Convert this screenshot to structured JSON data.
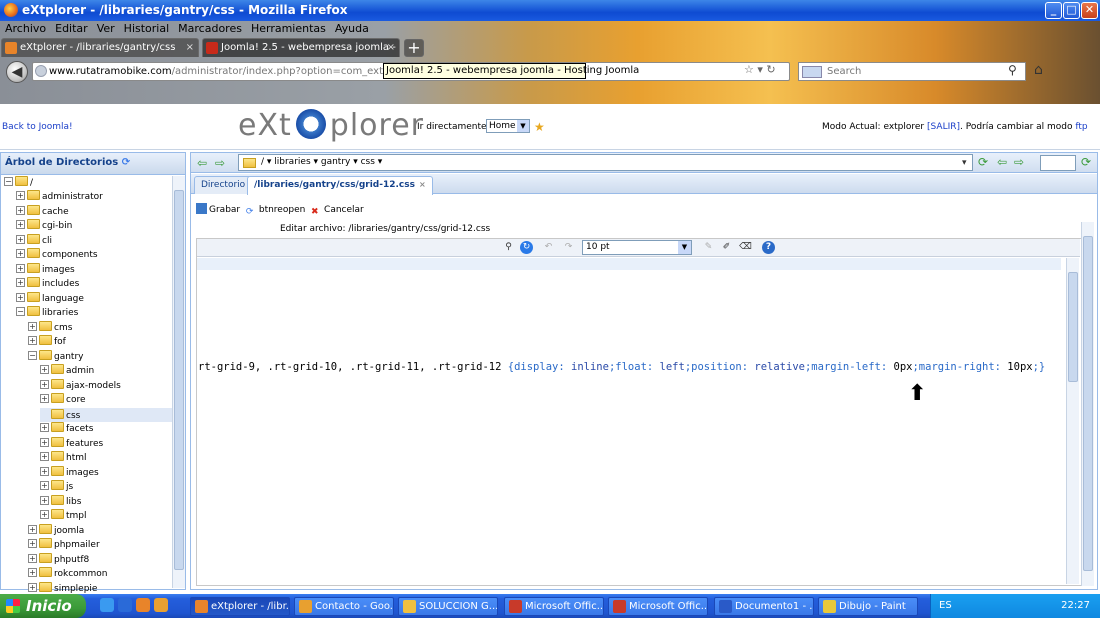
{
  "window": {
    "title": "eXtplorer - /libraries/gantry/css - Mozilla Firefox",
    "min": "_",
    "max": "□",
    "close": "✕"
  },
  "menubar": [
    "Archivo",
    "Editar",
    "Ver",
    "Historial",
    "Marcadores",
    "Herramientas",
    "Ayuda"
  ],
  "tabs": [
    {
      "label": "eXtplorer - /libraries/gantry/css",
      "close": "×"
    },
    {
      "label": "Joomla! 2.5 - webempresa joomla - Hosti...",
      "close": "×"
    }
  ],
  "newtab": "+",
  "nav": {
    "url_domain": "www.rutatramobike.com",
    "url_path": "/administrator/index.php?option=com_extplorer&tmpl=compo",
    "tooltip": "Joomla! 2.5 - webempresa joomla - Hosting Joomla",
    "search_placeholder": "Search"
  },
  "header": {
    "back_link": "Back to Joomla!",
    "logo_left": "eXt",
    "logo_right": "plorer",
    "goto_label": "Ir directamente a:",
    "goto_value": "Home",
    "mode_text": "Modo Actual: extplorer",
    "salir": "[SALIR]",
    "mode_suffix": ". Podría cambiar al modo",
    "ftp": "ftp"
  },
  "tree": {
    "title": "Árbol de Directorios",
    "root": "/",
    "items": [
      {
        "label": "administrator",
        "level": 1,
        "exp": "+"
      },
      {
        "label": "cache",
        "level": 1,
        "exp": "+"
      },
      {
        "label": "cgi-bin",
        "level": 1,
        "exp": "+"
      },
      {
        "label": "cli",
        "level": 1,
        "exp": "+"
      },
      {
        "label": "components",
        "level": 1,
        "exp": "+"
      },
      {
        "label": "images",
        "level": 1,
        "exp": "+"
      },
      {
        "label": "includes",
        "level": 1,
        "exp": "+"
      },
      {
        "label": "language",
        "level": 1,
        "exp": "+"
      },
      {
        "label": "libraries",
        "level": 1,
        "exp": "−"
      },
      {
        "label": "cms",
        "level": 2,
        "exp": "+"
      },
      {
        "label": "fof",
        "level": 2,
        "exp": "+"
      },
      {
        "label": "gantry",
        "level": 2,
        "exp": "−"
      },
      {
        "label": "admin",
        "level": 3,
        "exp": "+"
      },
      {
        "label": "ajax-models",
        "level": 3,
        "exp": "+"
      },
      {
        "label": "core",
        "level": 3,
        "exp": "+"
      },
      {
        "label": "css",
        "level": 3,
        "exp": "",
        "selected": true
      },
      {
        "label": "facets",
        "level": 3,
        "exp": "+"
      },
      {
        "label": "features",
        "level": 3,
        "exp": "+"
      },
      {
        "label": "html",
        "level": 3,
        "exp": "+"
      },
      {
        "label": "images",
        "level": 3,
        "exp": "+"
      },
      {
        "label": "js",
        "level": 3,
        "exp": "+"
      },
      {
        "label": "libs",
        "level": 3,
        "exp": "+"
      },
      {
        "label": "tmpl",
        "level": 3,
        "exp": "+"
      },
      {
        "label": "joomla",
        "level": 2,
        "exp": "+"
      },
      {
        "label": "phpmailer",
        "level": 2,
        "exp": "+"
      },
      {
        "label": "phputf8",
        "level": 2,
        "exp": "+"
      },
      {
        "label": "rokcommon",
        "level": 2,
        "exp": "+"
      },
      {
        "label": "simplepie",
        "level": 2,
        "exp": "+"
      }
    ]
  },
  "path": {
    "crumbs": "/ ▾  libraries ▾  gantry ▾  css ▾"
  },
  "editor_tabs": [
    {
      "label": "Directorio"
    },
    {
      "label": "/libraries/gantry/css/grid-12.css",
      "close": "×"
    }
  ],
  "edit_toolbar": {
    "save": "Grabar",
    "reopen": "btnreopen",
    "cancel": "Cancelar"
  },
  "edit_file_label": "Editar archivo: /libraries/gantry/css/grid-12.css",
  "font_size": "10 pt",
  "code": {
    "selectors": "rt-grid-9, .rt-grid-10, .rt-grid-11, .rt-grid-12 ",
    "open": "{",
    "p1": "display",
    "v1": " inline",
    "p2": "float",
    "v2": " left",
    "p3": "position",
    "v3": " relative",
    "p4": "margin-left",
    "v4": " 0px",
    "p5": "margin-right",
    "v5": " 10px",
    "close": "}"
  },
  "taskbar": {
    "start": "Inicio",
    "buttons": [
      "eXtplorer - /libr...",
      "Contacto - Goo...",
      "SOLUCCION G...",
      "Microsoft Offic...",
      "Microsoft Offic...",
      "Documento1 - ...",
      "Dibujo - Paint"
    ],
    "lang": "ES",
    "clock": "22:27"
  },
  "colors": {
    "accent": "#15428b",
    "link": "#1a3ec8",
    "taskbar": "#245edc"
  }
}
